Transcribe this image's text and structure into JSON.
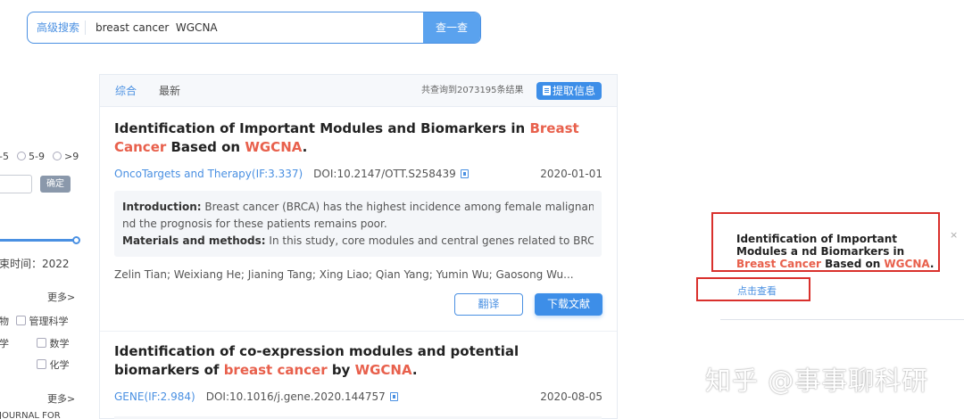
{
  "search": {
    "advanced_label": "高级搜索",
    "query": "breast cancer  WGCNA",
    "button_label": "查一查"
  },
  "left": {
    "range_1": "-5",
    "range_2": "5-9",
    "range_3": ">9",
    "confirm_label": "确定",
    "end_time": "束时间：2022",
    "more_1": "更多>",
    "subject_1": "物",
    "subject_2": "管理科学",
    "subject_3": "学",
    "subject_4": "数学",
    "subject_5": "化学",
    "more_2": "更多>",
    "journal": "JOURNAL FOR"
  },
  "results": {
    "tab_comprehensive": "综合",
    "tab_latest": "最新",
    "count_text": "共查询到2073195条结果",
    "extract_label": "提取信息",
    "articles": [
      {
        "title_a": "Identification of Important Modules and Biomarkers in ",
        "title_hl1": "Breast Cancer",
        "title_b": " Based on ",
        "title_hl2": "WGCNA",
        "title_c": ".",
        "journal": "OncoTargets and Therapy(IF:3.337)",
        "doi": "DOI:10.2147/OTT.S258439",
        "date": "2020-01-01",
        "intro_label": "Introduction:",
        "intro_text": " Breast cancer (BRCA) has the highest incidence among female malignancies, a",
        "intro_text2": "nd the prognosis for these patients remains poor.",
        "methods_label": "Materials and methods:",
        "methods_text": " In this study, core modules and central genes related to BRCA wer...",
        "authors": "Zelin Tian; Weixiang He; Jianing Tang; Xing Liao; Qian Yang; Yumin Wu; Gaosong Wu...",
        "review_label": "翻译",
        "download_label": "下载文献"
      },
      {
        "title_a": "Identification of co-expression modules and potential biomarkers of ",
        "title_hl1": "breast cancer",
        "title_b": " by ",
        "title_hl2": "WGCNA",
        "title_c": ".",
        "journal": "GENE(IF:2.984)",
        "doi": "DOI:10.1016/j.gene.2020.144757",
        "date": "2020-08-05"
      }
    ]
  },
  "popup": {
    "title_a": "Identification of Important Modules a nd Biomarkers in ",
    "title_hl1": "Breast Cancer",
    "title_b": " Based on ",
    "title_hl2": "WGCNA",
    "title_c": ".",
    "link_label": "点击查看",
    "close_icon": "×"
  },
  "watermark": "知乎 @事事聊科研",
  "colors": {
    "accent": "#4a90e2",
    "highlight": "#e8604c",
    "annotation_red": "#d9302c"
  }
}
